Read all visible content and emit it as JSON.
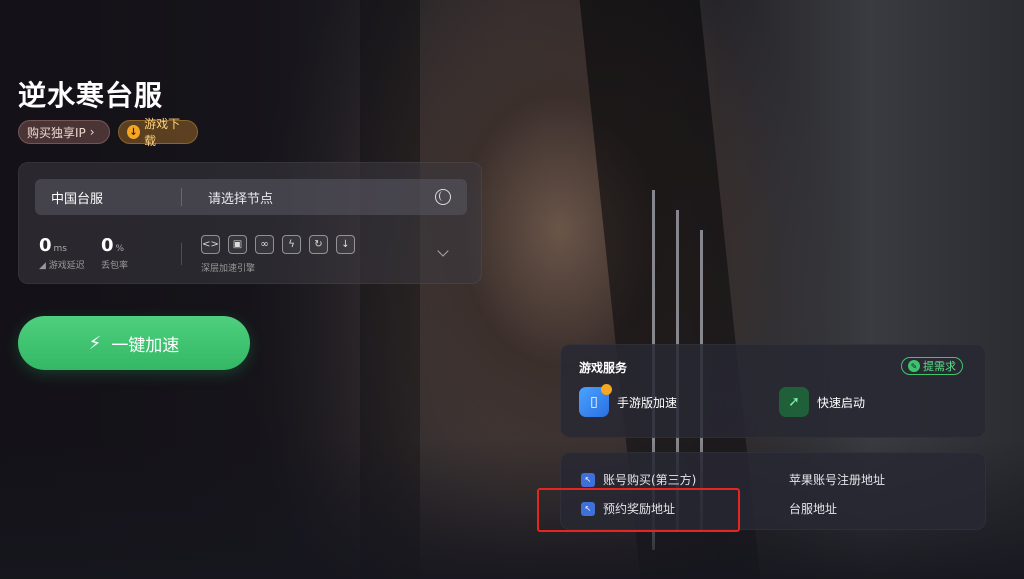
{
  "game": {
    "title": "逆水寒台服",
    "tag_ip": "购买独享IP",
    "tag_download": "游戏下载"
  },
  "panel": {
    "region": "中国台服",
    "node_placeholder": "请选择节点",
    "latency_value": "0",
    "latency_unit": "ms",
    "latency_label": "游戏延迟",
    "loss_value": "0",
    "loss_unit": "%",
    "loss_label": "丢包率",
    "engine_label": "深层加速引擎"
  },
  "accelerate_label": "一键加速",
  "services": {
    "title": "游戏服务",
    "request_label": "提需求",
    "items": [
      {
        "label": "手游版加速",
        "icon": "mobile-accel-icon"
      },
      {
        "label": "快速启动",
        "icon": "quick-launch-icon"
      }
    ]
  },
  "links": [
    {
      "label": "账号购买(第三方)"
    },
    {
      "label": "苹果账号注册地址"
    },
    {
      "label": "预约奖励地址"
    },
    {
      "label": "台服地址"
    }
  ],
  "colors": {
    "accent_green": "#3ec46d",
    "highlight_red": "#e3261f"
  }
}
